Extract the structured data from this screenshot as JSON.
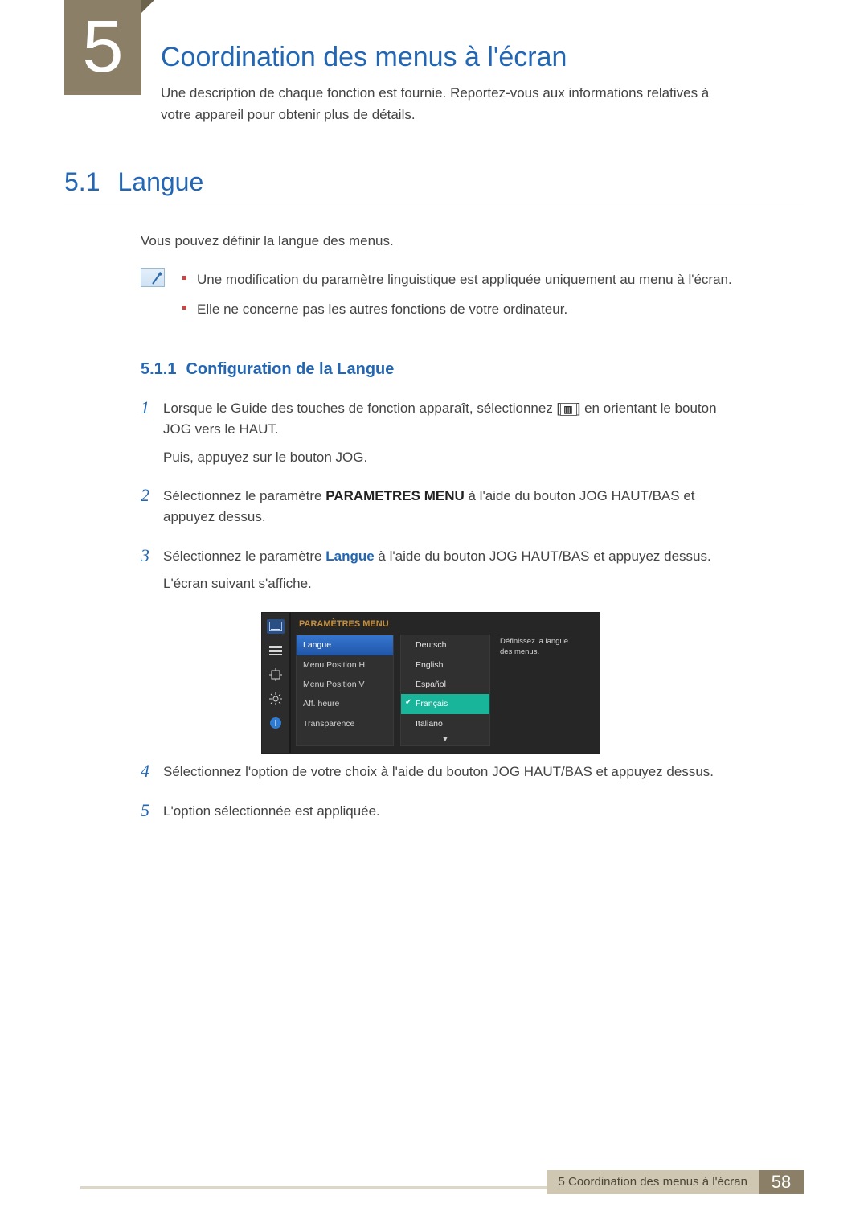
{
  "chapter": {
    "number": "5",
    "title": "Coordination des menus à l'écran",
    "desc": "Une description de chaque fonction est fournie. Reportez-vous aux informations relatives à votre appareil pour obtenir plus de détails."
  },
  "section": {
    "number": "5.1",
    "title": "Langue",
    "intro": "Vous pouvez définir la langue des menus."
  },
  "notes": {
    "0": "Une modification du paramètre linguistique est appliquée uniquement au menu à l'écran.",
    "1": "Elle ne concerne pas les autres fonctions de votre ordinateur."
  },
  "subsection": {
    "number": "5.1.1",
    "title": "Configuration de la Langue"
  },
  "steps": {
    "0": {
      "n": "1",
      "a": "Lorsque le Guide des touches de fonction apparaît, sélectionnez [",
      "b": "] en orientant le bouton JOG vers le HAUT.",
      "c": "Puis, appuyez sur le bouton JOG."
    },
    "1": {
      "n": "2",
      "pre": "Sélectionnez le paramètre ",
      "bold": "PARAMETRES MENU",
      "post": " à l'aide du bouton JOG HAUT/BAS et appuyez dessus."
    },
    "2": {
      "n": "3",
      "pre": "Sélectionnez le paramètre ",
      "bold": "Langue",
      "post": " à l'aide du bouton JOG HAUT/BAS et appuyez dessus.",
      "extra": "L'écran suivant s'affiche."
    },
    "3": {
      "n": "4",
      "t": "Sélectionnez l'option de votre choix à l'aide du bouton JOG HAUT/BAS et appuyez dessus."
    },
    "4": {
      "n": "5",
      "t": "L'option sélectionnée est appliquée."
    }
  },
  "osd": {
    "title": "PARAMÈTRES MENU",
    "help": "Définissez la langue des menus.",
    "menu": {
      "0": "Langue",
      "1": "Menu Position H",
      "2": "Menu Position V",
      "3": "Aff. heure",
      "4": "Transparence"
    },
    "opts": {
      "0": "Deutsch",
      "1": "English",
      "2": "Español",
      "3": "Français",
      "4": "Italiano"
    },
    "arrow": "▼"
  },
  "footer": {
    "text": "5 Coordination des menus à l'écran",
    "page": "58"
  }
}
